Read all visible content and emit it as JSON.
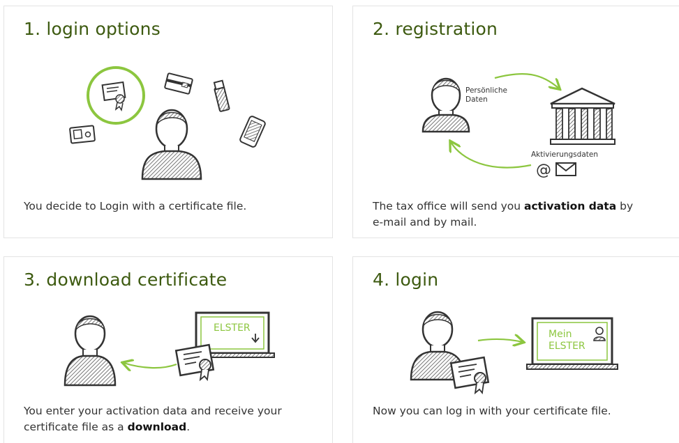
{
  "colors": {
    "accent": "#8cc63f",
    "heading": "#3d5a10",
    "text": "#333333",
    "border": "#e3e3e3"
  },
  "cards": [
    {
      "title": "1. login options",
      "text_before": "You decide to Login with a certificate file.",
      "bold": "",
      "text_after": "",
      "icons": [
        "certificate-icon",
        "id-card-icon",
        "bank-card-icon",
        "usb-stick-icon",
        "smartphone-icon",
        "person-icon"
      ]
    },
    {
      "title": "2. registration",
      "text_before": "The tax office will send you ",
      "bold": "activation data",
      "text_after": " by",
      "text_line2": "e-mail and by mail.",
      "label_personal": "Persönliche",
      "label_personal2": "Daten",
      "label_activation": "Aktivierungsdaten",
      "at_sign": "@",
      "icons": [
        "person-icon",
        "tax-office-building-icon",
        "at-icon",
        "envelope-icon",
        "arrow-icon"
      ]
    },
    {
      "title": "3. download certificate",
      "text_before": "You enter your activation data and receive your",
      "text_line2_before": "certificate file as a ",
      "bold": "download",
      "text_after": ".",
      "screen_label": "ELSTER",
      "icons": [
        "person-icon",
        "certificate-icon",
        "laptop-icon",
        "download-arrow-icon",
        "arrow-icon"
      ]
    },
    {
      "title": "4. login",
      "text_before": "Now you can log in with your certificate file.",
      "screen_label1": "Mein",
      "screen_label2": "ELSTER",
      "icons": [
        "person-icon",
        "certificate-icon",
        "laptop-icon",
        "user-icon",
        "arrow-icon"
      ]
    }
  ]
}
